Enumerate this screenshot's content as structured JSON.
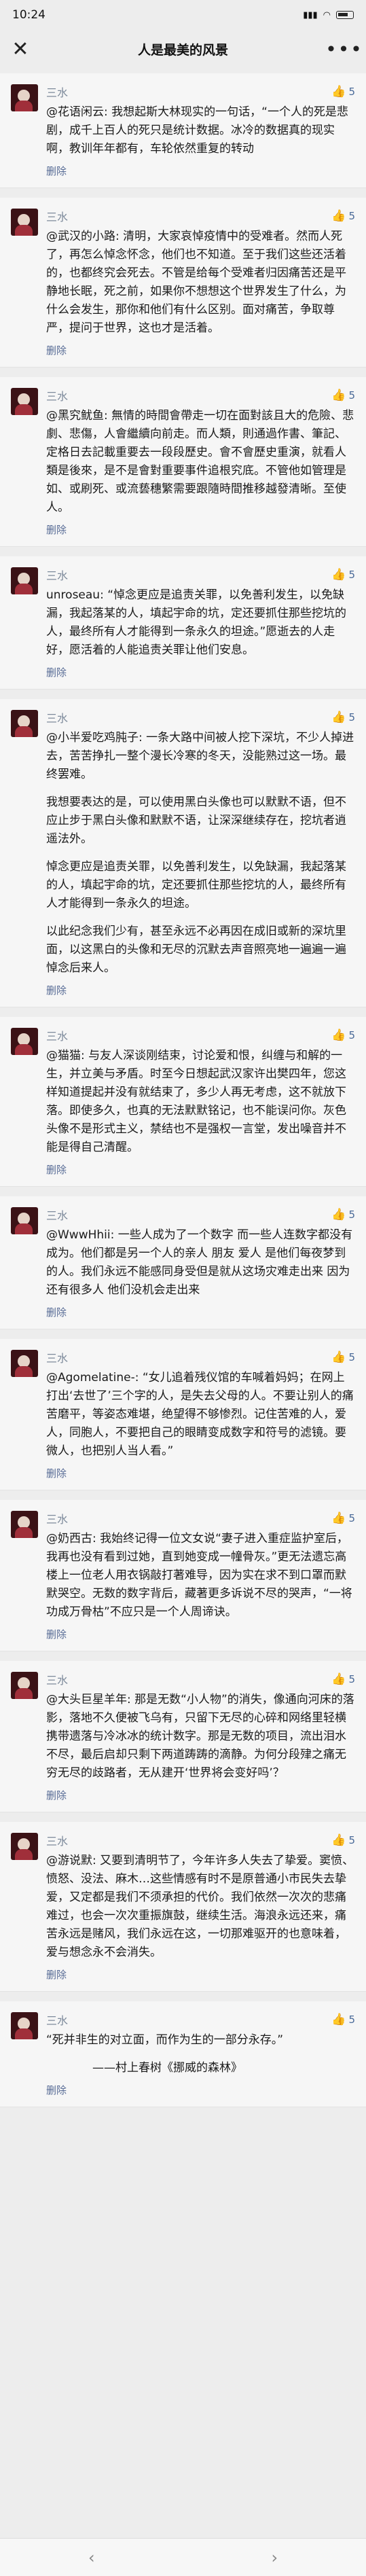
{
  "status": {
    "time": "10:24",
    "icons": "⁢ ▲ ● 57"
  },
  "nav": {
    "close": "✕",
    "title": "人是最美的风景",
    "more": "•••"
  },
  "delete_label": "删除",
  "comments": [
    {
      "name": "三水",
      "likes": "5",
      "text": "@花语闲云: 我想起斯大林现实的一句话，“一个人的死是悲剧，成千上百人的死只是统计数据。冰冷的数据真的现实啊，教训年年都有，车轮依然重复的转动"
    },
    {
      "name": "三水",
      "likes": "5",
      "text": "@武汉的小路: 清明，大家哀悼疫情中的受难者。然而人死了，再怎么悼念怀念，他们也不知道。至于我们这些还活着的，也都终究会死去。不管是给每个受难者归因痛苦还是平静地长眠，死之前，如果你不想想这个世界发生了什么，为什么会发生，那你和他们有什么区别。面对痛苦，争取尊严，提问于世界，这也才是活着。"
    },
    {
      "name": "三水",
      "likes": "5",
      "text": "@黑究鱿鱼: 無情的時間會帶走一切在面對該且大的危險、悲劇、悲傷，人會繼續向前走。而人類，則通過作書、筆記、定格日去記載重要去一段段歷史。會不會歷史重演，就看人類是後來，是不是會對重要事件追根究底。不管他如管理是如、或刷死、或流兿穗繁需要跟隨時間推移越發清晰。至使人。"
    },
    {
      "name": "三水",
      "likes": "5",
      "text": "unroseau: “悼念更应是追责关罪，以免善利发生，以免缺漏，我起落某的人，填起宇命的坑，定还要抓住那些挖坑的人，最终所有人才能得到一条永久的坦途。”愿逝去的人走好，愿活着的人能追责关罪让他们安息。"
    },
    {
      "name": "三水",
      "likes": "5",
      "paragraphs": [
        "@小半爱吃鸡肫子: 一条大路中间被人挖下深坑，不少人掉进去，苦苦挣扎一整个漫长冷寒的冬天，没能熟过这一场。最终罢难。",
        "我想要表达的是，可以使用黑白头像也可以默默不语，但不应止步于黑白头像和默默不语，让深深继续存在，挖坑者逍遥法外。",
        "悼念更应是追责关罪，以免善利发生，以免缺漏，我起落某的人，填起宇命的坑，定还要抓住那些挖坑的人，最终所有人才能得到一条永久的坦途。",
        "以此纪念我们少有，甚至永远不必再因在成旧或新的深坑里面，以这黑白的头像和无尽的沉默去声音照亮地一遍遍一遍悼念后来人。"
      ]
    },
    {
      "name": "三水",
      "likes": "5",
      "text": "@猫猫: 与友人深谈刚结束，讨论爱和恨，纠缠与和解的一生，并立美与矛盾。时至今日想起武汉家许出樊四年，您这样知道提起并没有就结束了，多少人再无考虑，这不就放下落。即使多久，也真的无法默默铭记，也不能误问你。灰色头像不是形式主义，禁结也不是强权一言堂，发出噪音并不能是得自己清醒。"
    },
    {
      "name": "三水",
      "likes": "5",
      "text": "@WwwHhii: 一些人成为了一个数字 而一些人连数字都没有成为。他们都是另一个人的亲人 朋友 爱人 是他们每夜梦到的人。我们永远不能感同身受但是就从这场灾难走出来 因为还有很多人 他们没机会走出来"
    },
    {
      "name": "三水",
      "likes": "5",
      "text": "@Agomelatine-: “女儿追着残仪馆的车喊着妈妈；在网上打出‘去世了’三个字的人，是失去父母的人。不要让别人的痛苦磨平，等姿态难堪，绝望得不够惨烈。记住苦难的人，爱人，同胞人，不要把自己的眼睛变成数字和符号的滤镜。要微人，也把别人当人看。”"
    },
    {
      "name": "三水",
      "likes": "5",
      "text": "@奶西古: 我始终记得一位文女说“妻子进入重症监护室后，我再也没有看到过她，直到她变成一幢骨灰。”更无法遗忘高楼上一位老人用衣锅敲打著难导，因为实在求不到口罩而默默哭空。无数的数字背后，藏著更多诉说不尽的哭声，“一将功成万骨枯”不应只是一个人周谛诀。"
    },
    {
      "name": "三水",
      "likes": "5",
      "text": "@大头巨星羊年: 那是无数“小人物”的消失，像通向河床的落影，落地不久便被飞乌有，只留下无尽的心碎和网络里轻横携带遗落与冷冰冰的统计数字。那是无数的项目，流出泪水不尽，最后启却只剩下两道踌踌的滴静。为何分段肂之痛无穷无尽的歧路者，无从建开‘世界将会变好吗’？"
    },
    {
      "name": "三水",
      "likes": "5",
      "text": "@游说默: 又要到清明节了，今年许多人失去了挚爱。窦愤、愤怒、没法、麻木…这些情感有时不是原普通小市民失去挚爱，又定都是我们不须承担的代价。我们依然一次次的悲痛难过，也会一次次重振旗鼓，继续生活。海浪永远还来，痛苦永远是赌风，我们永远在这，一切那难驱开的也意味着，爱与想念永不会消失。"
    },
    {
      "name": "三水",
      "likes": "5",
      "paragraphs": [
        "“死并非生的对立面，而作为生的一部分永存。”",
        "　　　　——村上春树《挪威的森林》"
      ]
    }
  ],
  "footer": {
    "back": "‹",
    "forward": "›"
  }
}
